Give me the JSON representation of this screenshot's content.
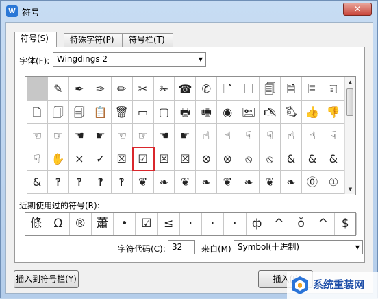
{
  "window": {
    "title": "符号",
    "app_icon_text": "W",
    "close_glyph": "✕"
  },
  "tabs": [
    {
      "label": "符号(S)",
      "active": true
    },
    {
      "label": "特殊字符(P)",
      "active": false
    },
    {
      "label": "符号栏(T)",
      "active": false
    }
  ],
  "font": {
    "label": "字体(F):",
    "value": "Wingdings 2"
  },
  "symbol_grid": {
    "selected_index": 50,
    "rows": [
      [
        "",
        "✎",
        "✒",
        "✑",
        "✏",
        "✂",
        "✁",
        "☎",
        "✆",
        "🗋",
        "🗌",
        "🗐",
        "🗎",
        "🗏",
        "🗊"
      ],
      [
        "🗋",
        "🗍",
        "🗐",
        "📋",
        "🗑",
        "▭",
        "▢",
        "🖶",
        "🖷",
        "◉",
        "🖭",
        "🖎",
        "🖏",
        "👍",
        "👎"
      ],
      [
        "☜",
        "☞",
        "☚",
        "☛",
        "☜",
        "☞",
        "☚",
        "☛",
        "☝",
        "☝",
        "☟",
        "☟",
        "☝",
        "☝",
        "☟"
      ],
      [
        "☟",
        "✋",
        "×",
        "✓",
        "☒",
        "☑",
        "☒",
        "☒",
        "⊗",
        "⊗",
        "⦸",
        "⦸",
        "&",
        "&",
        "&"
      ],
      [
        "&",
        "‽",
        "‽",
        "‽",
        "‽",
        "❦",
        "❧",
        "❦",
        "❧",
        "❦",
        "❧",
        "❦",
        "❧",
        "⓪",
        "①"
      ]
    ]
  },
  "scrollbar": {
    "up_glyph": "▲",
    "down_glyph": "▼"
  },
  "recent": {
    "label": "近期使用过的符号(R):",
    "symbols": [
      "條",
      "Ω",
      "®",
      "蕭",
      "•",
      "☑",
      "≤",
      "·",
      "·",
      "·",
      "ф",
      "^",
      "ǒ",
      "^",
      "$"
    ]
  },
  "char_code": {
    "label": "字符代码(C):",
    "value": "32",
    "from_label": "来自(M)",
    "from_value": "Symbol(十进制)",
    "arrow_glyph": "▼"
  },
  "buttons": {
    "insert_to_bar": "插入到符号栏(Y)",
    "insert": "插入(I)"
  },
  "watermark": {
    "text": "系统重装网"
  },
  "colors": {
    "selection_outline": "#d9272c",
    "app_icon": "#2a77d6",
    "close_button": "#c8453a",
    "watermark_text": "#1f4fa8"
  }
}
